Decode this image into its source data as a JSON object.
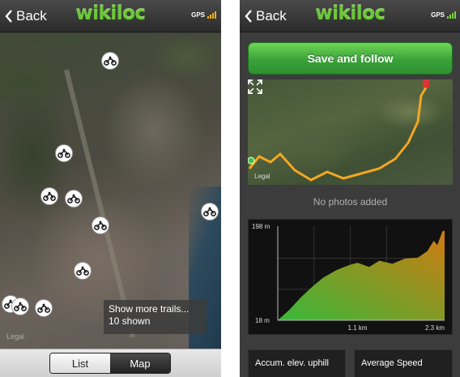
{
  "left": {
    "nav": {
      "back_label": "Back",
      "logo": "wikiloc",
      "gps": "GPS"
    },
    "map": {
      "legal": "Legal",
      "more_trails_line1": "Show more trails...",
      "more_trails_line2": "10 shown"
    },
    "tabs": [
      {
        "label": "List",
        "selected": false
      },
      {
        "label": "Map",
        "selected": true
      }
    ]
  },
  "right": {
    "nav": {
      "back_label": "Back",
      "logo": "wikiloc",
      "gps": "GPS"
    },
    "save_button": "Save and follow",
    "map_legal": "Legal",
    "no_photos": "No photos added",
    "cards": {
      "elev": "Accum. elev. uphill",
      "speed": "Average Speed"
    }
  },
  "chart_data": {
    "type": "area",
    "title": "",
    "xlabel": "",
    "ylabel": "",
    "ylim": [
      18,
      198
    ],
    "xlim": [
      0,
      2.3
    ],
    "yticks": [
      "198 m",
      "18 m"
    ],
    "xticks": [
      "1.1 km",
      "2.3 km"
    ],
    "x": [
      0.0,
      0.16,
      0.32,
      0.49,
      0.63,
      0.81,
      0.99,
      1.1,
      1.26,
      1.4,
      1.58,
      1.75,
      1.93,
      2.06,
      2.15,
      2.2,
      2.27,
      2.3
    ],
    "y": [
      18,
      38,
      62,
      84,
      100,
      114,
      124,
      128,
      120,
      132,
      126,
      136,
      138,
      150,
      170,
      162,
      188,
      190
    ],
    "colors": {
      "low": "#38b83a",
      "high": "#d07a10",
      "background": "#111111"
    }
  },
  "icons": {
    "poi": "motorbike-icon",
    "back": "chevron-left-icon",
    "expand": "expand-icon"
  }
}
